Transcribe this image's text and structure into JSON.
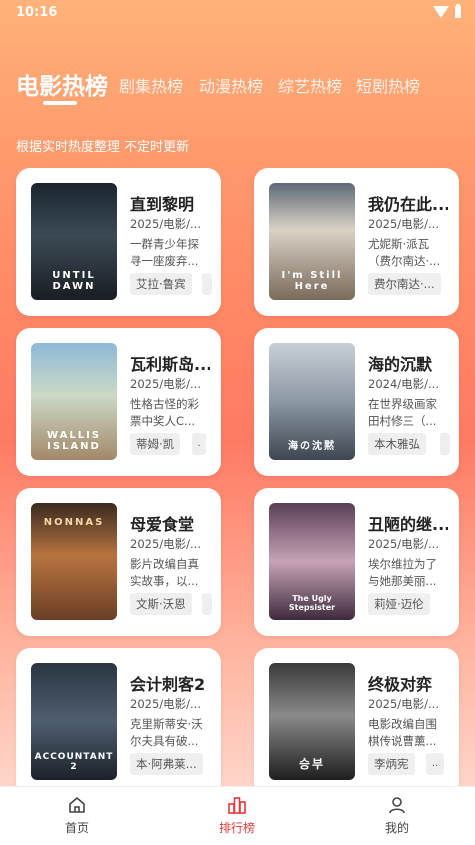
{
  "status_bar": {
    "time": "10:16"
  },
  "tabs": [
    {
      "label": "电影热榜"
    },
    {
      "label": "剧集热榜"
    },
    {
      "label": "动漫热榜"
    },
    {
      "label": "综艺热榜"
    },
    {
      "label": "短剧热榜"
    }
  ],
  "subtitle": "根据实时热度整理 不定时更新",
  "cards": [
    {
      "title": "直到黎明",
      "meta": "2025/电影/...",
      "desc": "一群青少年探寻一座废弃...",
      "tag": "艾拉·鲁宾",
      "tag2": "",
      "poster_text": "UNTIL DAWN"
    },
    {
      "title": "我仍在此...",
      "meta": "2025/电影/...",
      "desc": "尤妮斯·派瓦（费尔南达·...",
      "tag": "费尔南达·...",
      "tag2": "",
      "poster_text": "I'm Still Here"
    },
    {
      "title": "瓦利斯岛...",
      "meta": "2025/电影/...",
      "desc": "性格古怪的彩票中奖人C...",
      "tag": "蒂姆·凯",
      "tag2": ".",
      "poster_text": "WALLIS ISLAND"
    },
    {
      "title": "海的沉默",
      "meta": "2024/电影/...",
      "desc": "在世界级画家田村修三（...",
      "tag": "本木雅弘",
      "tag2": "",
      "poster_text": "海の沈黙"
    },
    {
      "title": "母爱食堂",
      "meta": "2025/电影/...",
      "desc": "影片改编自真实故事，以...",
      "tag": "文斯·沃恩",
      "tag2": "",
      "poster_text": "NONNAS"
    },
    {
      "title": "丑陋的继...",
      "meta": "2025/电影/...",
      "desc": "埃尔维拉为了与她那美丽...",
      "tag": "莉娅·迈伦",
      "tag2": "",
      "poster_text": "The Ugly Stepsister"
    },
    {
      "title": "会计刺客2",
      "meta": "2025/电影/...",
      "desc": "克里斯蒂安·沃尔夫具有破...",
      "tag": "本·阿弗莱...",
      "tag2": "",
      "poster_text": "ACCOUNTANT 2"
    },
    {
      "title": "终极对弈",
      "meta": "2025/电影/...",
      "desc": "电影改编自围棋传说曹薰...",
      "tag": "李炳宪",
      "tag2": "..",
      "poster_text": "승부"
    }
  ],
  "bottom_nav": [
    {
      "label": "首页",
      "icon": "home-icon"
    },
    {
      "label": "排行榜",
      "icon": "ranking-icon"
    },
    {
      "label": "我的",
      "icon": "user-icon"
    }
  ],
  "colors": {
    "accent": "#e23a3a"
  }
}
